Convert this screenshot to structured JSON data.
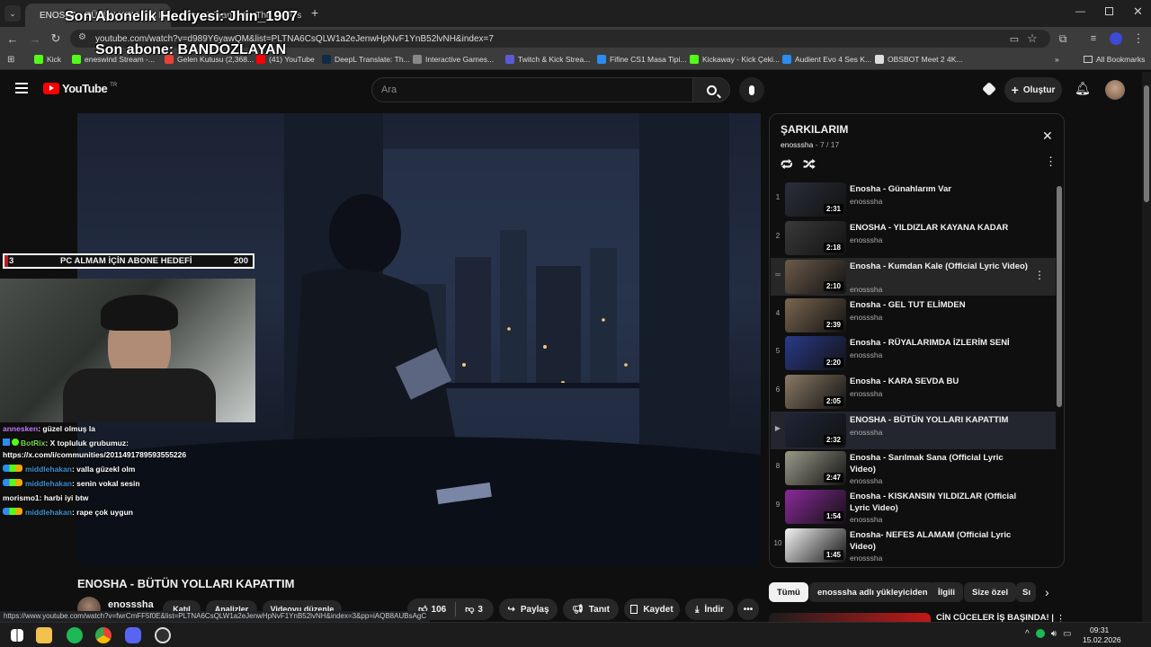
{
  "browser": {
    "tabs": [
      {
        "label": "ENOSHA - BÜTÜN YOLLARI K",
        "active": true
      },
      {
        "label": "DeepL Translate: The world's",
        "active": false
      }
    ],
    "new_tab_symbol": "+",
    "url": "youtube.com/watch?v=d989Y6yawQM&list=PLTNA6CsQLW1a2eJenwHpNvF1YnB52lvNH&index=7",
    "bookmarks": [
      {
        "label": "Kick",
        "color": "#53fc18"
      },
      {
        "label": "eneswind Stream -...",
        "color": "#53fc18"
      },
      {
        "label": "Gelen Kutusu (2,368...",
        "color": "#ea4335"
      },
      {
        "label": "(41) YouTube",
        "color": "#ff0000"
      },
      {
        "label": "DeepL Translate: Th...",
        "color": "#0f2b46"
      },
      {
        "label": "Interactive Games...",
        "color": "#888888"
      },
      {
        "label": "Twitch & Kick Strea...",
        "color": "#5b5bd6"
      },
      {
        "label": "Fifine CS1 Masa Tipi...",
        "color": "#2d8cf0"
      },
      {
        "label": "Kickaway - Kick Çeki...",
        "color": "#53fc18"
      },
      {
        "label": "Audient Evo 4 Ses K...",
        "color": "#2d8cf0"
      },
      {
        "label": "OBSBOT Meet 2 4K...",
        "color": "#dddddd"
      }
    ],
    "more_bookmarks": "»",
    "all_bookmarks": "All Bookmarks"
  },
  "overlay": {
    "sub_gift": "Son Abonelik Hediyesi: Jhin_1907",
    "last_sub": "Son abone: BANDOZLAYAN",
    "goal_current": "3",
    "goal_label": "PC ALMAM İÇİN ABONE HEDEFİ",
    "goal_target": "200",
    "goal_progress": 0.015
  },
  "chat": [
    {
      "user": "annesken",
      "text": ": güzel olmuş la",
      "color": "#c77dff"
    },
    {
      "user": "BotRix",
      "text": ": X topluluk grubumuz:",
      "color": "#7bd84d"
    },
    {
      "user": "",
      "text": "https://x.com/i/communities/2011491789593555226",
      "color": "#ffffff"
    },
    {
      "user": "middlehakan",
      "text": ": valla güzekl olm",
      "color": "#3e8ed0"
    },
    {
      "user": "middlehakan",
      "text": ": senin vokal sesin",
      "color": "#3e8ed0"
    },
    {
      "user": "morismo1",
      "text": ": harbi iyi btw",
      "color": "#ffffff"
    },
    {
      "user": "middlehakan",
      "text": ": rape çok uygun",
      "color": "#3e8ed0"
    }
  ],
  "youtube": {
    "logo_text": "YouTube",
    "logo_sup": "TR",
    "search_placeholder": "Ara",
    "create_label": "Oluştur"
  },
  "video": {
    "title": "ENOSHA - BÜTÜN YOLLARI KAPATTIM",
    "channel": "enosssha",
    "join_label": "Katıl",
    "analytics_label": "Analizler",
    "edit_label": "Videoyu düzenle",
    "likes": "106",
    "dislikes": "3",
    "share_label": "Paylaş",
    "promote_label": "Tanıt",
    "save_label": "Kaydet",
    "download_label": "İndir"
  },
  "playlist": {
    "title": "ŞARKILARIM",
    "owner": "enosssha",
    "position": "7 / 17",
    "items": [
      {
        "index": "1",
        "title": "Enosha - Günahlarım Var",
        "channel": "enosssha",
        "duration": "2:31",
        "thumb": "#2a2f3a"
      },
      {
        "index": "2",
        "title": "ENOSHA - YILDIZLAR KAYANA KADAR",
        "channel": "enosssha",
        "duration": "2:18",
        "thumb": "#3a3a3a"
      },
      {
        "index": "",
        "title": "Enosha - Kumdan Kale (Official Lyric Video)",
        "channel": "enosssha",
        "duration": "2:10",
        "thumb": "#6b5a4a"
      },
      {
        "index": "4",
        "title": "Enosha - GEL TUT ELİMDEN",
        "channel": "enosssha",
        "duration": "2:39",
        "thumb": "#7a6650"
      },
      {
        "index": "5",
        "title": "Enosha - RÜYALARIMDA İZLERİM SENİ",
        "channel": "enosssha",
        "duration": "2:20",
        "thumb": "#2a3a8a"
      },
      {
        "index": "6",
        "title": "Enosha - KARA SEVDA BU",
        "channel": "enosssha",
        "duration": "2:05",
        "thumb": "#8a7a66"
      },
      {
        "index": "▶",
        "title": "ENOSHA - BÜTÜN YOLLARI KAPATTIM",
        "channel": "enosssha",
        "duration": "2:32",
        "thumb": "#1e2638"
      },
      {
        "index": "8",
        "title": "Enosha - Sarılmak Sana (Official Lyric Video)",
        "channel": "enosssha",
        "duration": "2:47",
        "thumb": "#9a9a8a"
      },
      {
        "index": "9",
        "title": "Enosha - KISKANSIN YILDIZLAR (Official Lyric Video)",
        "channel": "enosssha",
        "duration": "1:54",
        "thumb": "#8a2a9a"
      },
      {
        "index": "10",
        "title": "Enosha- NEFES ALAMAM (Official Lyric Video)",
        "channel": "enosssha",
        "duration": "1:45",
        "thumb": "#f4f4f4"
      }
    ]
  },
  "chips": [
    "Tümü",
    "enosssha adlı yükleyiciden",
    "İlgili",
    "Size özel",
    "Sı"
  ],
  "recommendation": {
    "title": "CİN CÜCELER İŞ BAŞINDA! |"
  },
  "status_url": "https://www.youtube.com/watch?v=fwrCmFF5f0E&list=PLTNA6CsQLW1a2eJenwHpNvF1YnB52lvNH&index=3&pp=iAQB8AUBsAgC",
  "taskbar": {
    "time": "09:31",
    "date": "15.02.2026"
  }
}
